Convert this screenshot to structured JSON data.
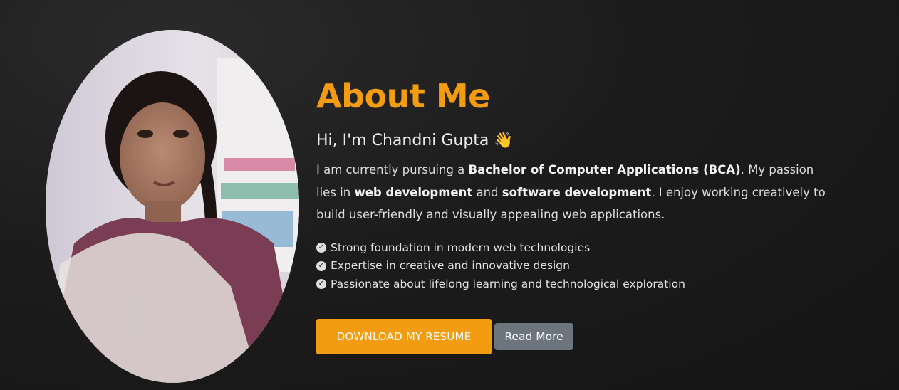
{
  "about": {
    "title": "About Me",
    "greeting": "Hi, I'm Chandni Gupta",
    "wave_emoji": "👋",
    "bio": {
      "t1": "I am currently pursuing a ",
      "b1": "Bachelor of Computer Applications (BCA)",
      "t2": ". My passion lies in ",
      "b2": "web development",
      "t3": " and ",
      "b3": "software development",
      "t4": ". I enjoy working creatively to build user-friendly and visually appealing web applications."
    },
    "features": [
      {
        "icon": "check-circle-icon",
        "text": "Strong foundation in modern web technologies"
      },
      {
        "icon": "check-circle-icon",
        "text": "Expertise in creative and innovative design"
      },
      {
        "icon": "check-circle-icon",
        "text": "Passionate about lifelong learning and technological exploration"
      }
    ],
    "buttons": {
      "resume": "DOWNLOAD MY RESUME",
      "read_more": "Read More"
    }
  },
  "colors": {
    "accent": "#f39c12",
    "background": "#1c1c1c",
    "secondary_button": "#6c757d"
  }
}
